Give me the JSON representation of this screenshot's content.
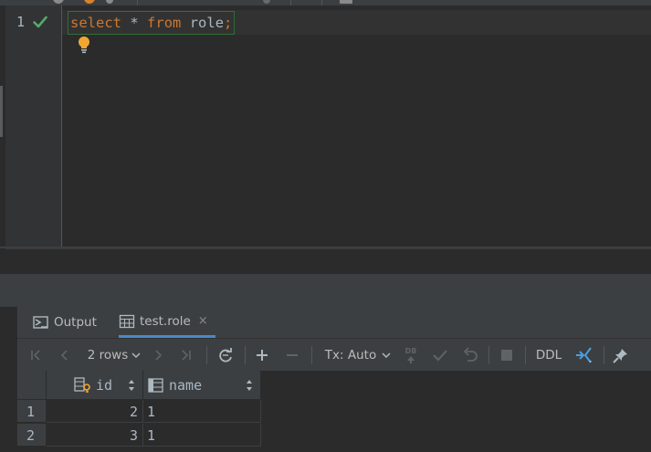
{
  "colors": {
    "editor_bg": "#2b2b2b",
    "panel_bg": "#3c3f41",
    "keyword": "#cc7832",
    "text": "#a9b7c6",
    "check_green": "#59a869",
    "bulb_yellow": "#f0a732",
    "accent_blue": "#4a88c7"
  },
  "editor": {
    "line_number": "1",
    "status_icon": "check-icon",
    "hint_icon": "lightbulb-icon",
    "code": {
      "kw_select": "select",
      "star": "*",
      "kw_from": "from",
      "table": "role",
      "semicolon": ";"
    }
  },
  "results": {
    "tabs": [
      {
        "label": "Output",
        "icon": "console-output-icon"
      },
      {
        "label": "test.role",
        "icon": "table-icon",
        "close": "×"
      }
    ],
    "toolbar": {
      "rows_label": "2 rows",
      "tx_label": "Tx: Auto",
      "db_label": "DB",
      "ddl_label": "DDL"
    },
    "columns": [
      {
        "label": "id",
        "icon": "key-column-icon"
      },
      {
        "label": "name",
        "icon": "column-icon"
      }
    ],
    "rows": [
      {
        "num": "1",
        "id": "2",
        "name": "1"
      },
      {
        "num": "2",
        "id": "3",
        "name": "1"
      }
    ]
  }
}
